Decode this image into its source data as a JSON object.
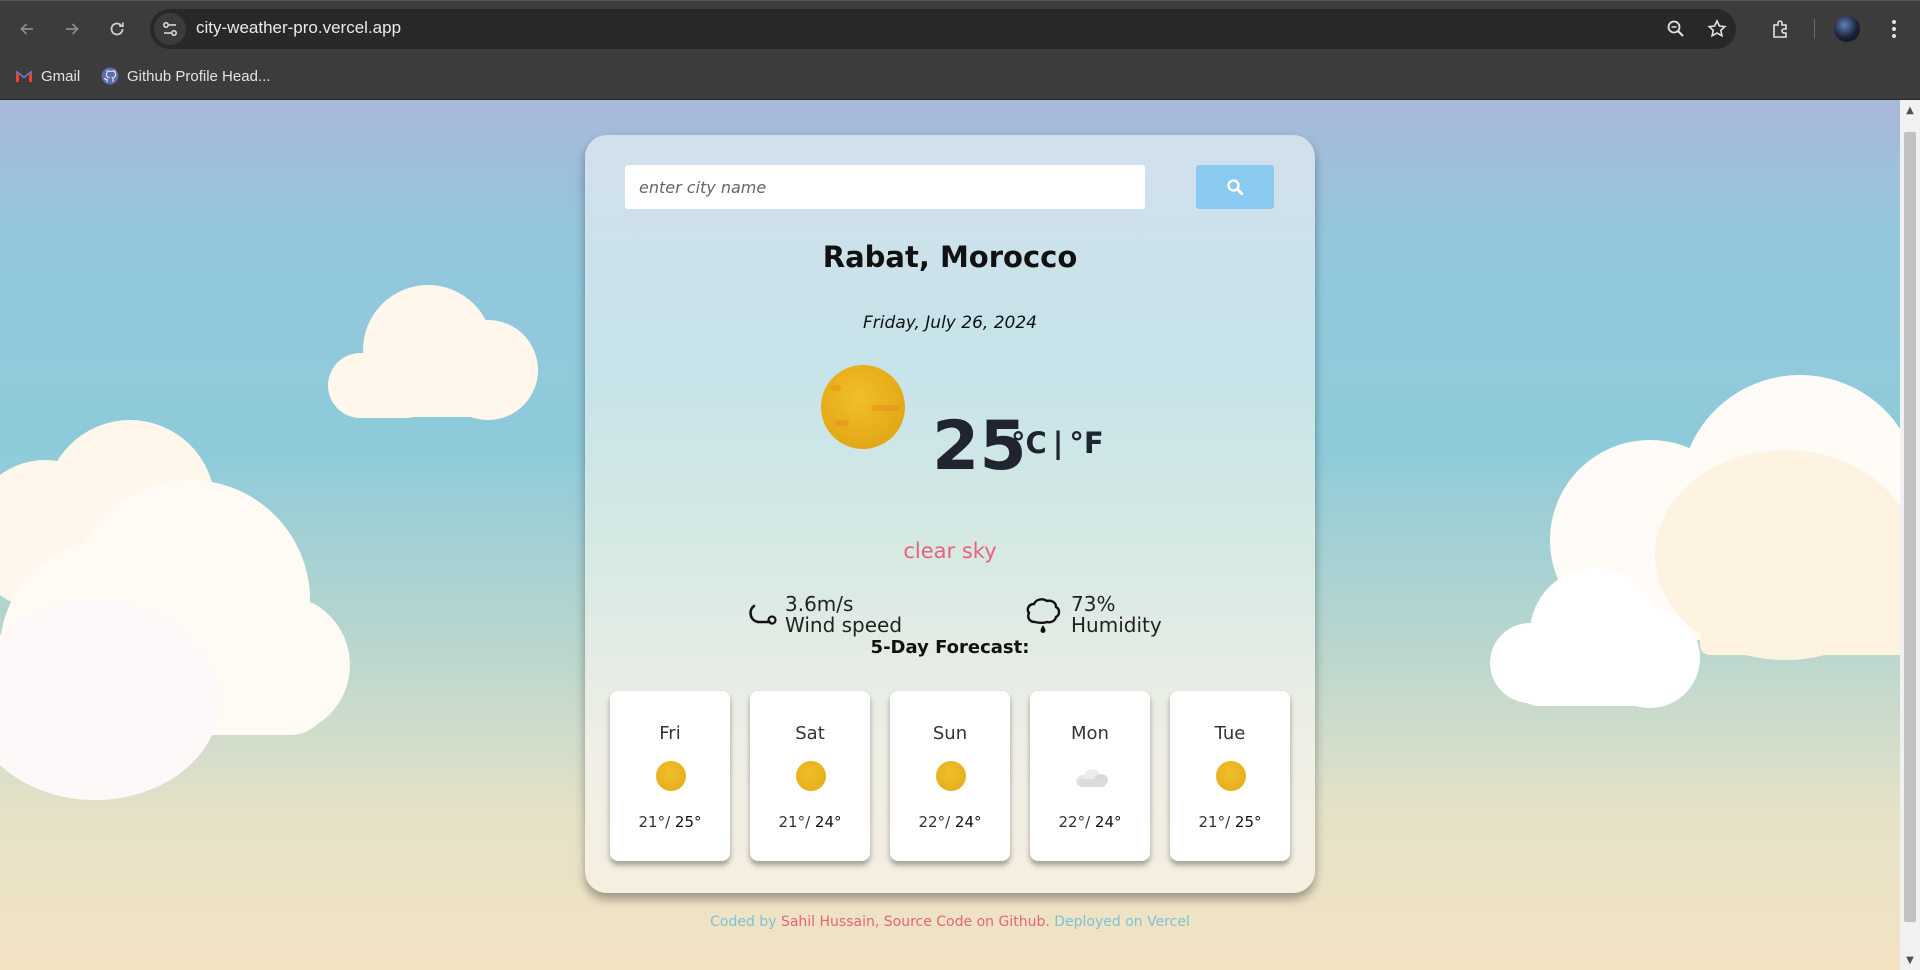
{
  "browser": {
    "url": "city-weather-pro.vercel.app",
    "bookmarks": [
      {
        "label": "Gmail",
        "icon": "gmail-icon"
      },
      {
        "label": "Github Profile Head...",
        "icon": "github-icon"
      }
    ]
  },
  "search": {
    "placeholder": "enter city name",
    "value": ""
  },
  "weather": {
    "city": "Rabat, Morocco",
    "date": "Friday, July 26, 2024",
    "temperature": "25",
    "unit_c": "°C",
    "unit_separator": "|",
    "unit_f": "°F",
    "description": "clear sky",
    "icon": "sun-icon",
    "wind": {
      "value": "3.6m/s",
      "label": "Wind speed",
      "icon": "wind-icon"
    },
    "humidity": {
      "value": "73%",
      "label": "Humidity",
      "icon": "humidity-icon"
    }
  },
  "forecast": {
    "title": "5-Day Forecast:",
    "days": [
      {
        "day": "Fri",
        "low": "21°/",
        "high": "25°",
        "icon": "sun-icon"
      },
      {
        "day": "Sat",
        "low": "21°/",
        "high": "24°",
        "icon": "sun-icon"
      },
      {
        "day": "Sun",
        "low": "22°/",
        "high": "24°",
        "icon": "sun-icon"
      },
      {
        "day": "Mon",
        "low": "22°/",
        "high": "24°",
        "icon": "cloud-icon"
      },
      {
        "day": "Tue",
        "low": "21°/",
        "high": "25°",
        "icon": "sun-icon"
      }
    ]
  },
  "footer": {
    "coded_by": "Coded by ",
    "author": "Sahil Hussain",
    "comma": ", ",
    "source": "Source Code on Github",
    "period": ". ",
    "deployed": "Deployed on Vercel"
  },
  "colors": {
    "accent_pink": "#e5637d",
    "search_button": "#8bcaf0",
    "footer_blue": "#7fc1d6"
  }
}
